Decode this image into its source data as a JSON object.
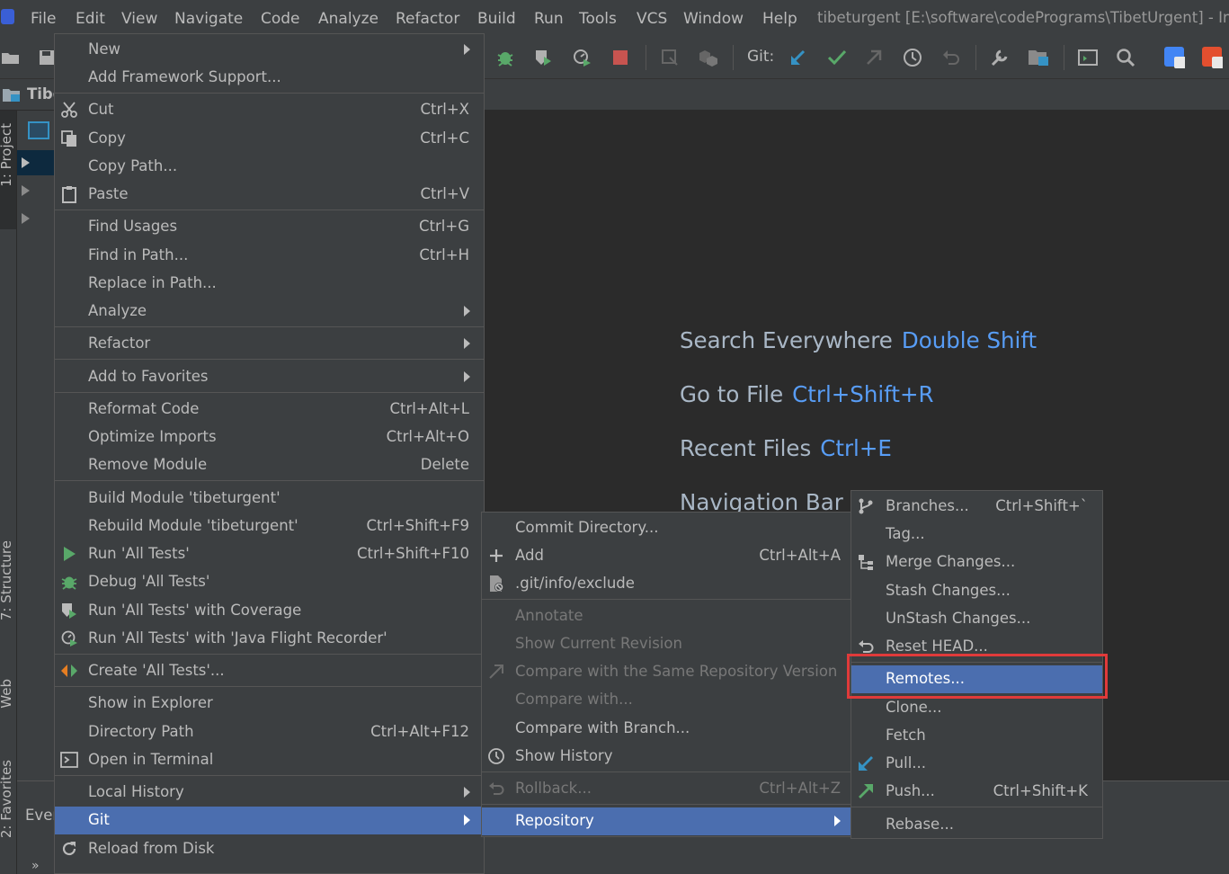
{
  "menubar": {
    "items": [
      "File",
      "Edit",
      "View",
      "Navigate",
      "Code",
      "Analyze",
      "Refactor",
      "Build",
      "Run",
      "Tools",
      "VCS",
      "Window",
      "Help"
    ],
    "title": "tibeturgent [E:\\software\\codePrograms\\TibetUrgent] - In"
  },
  "toolbar": {
    "git_label": "Git:"
  },
  "navbar": {
    "crumb": "Tibe"
  },
  "side_tabs": {
    "project": "1: Project",
    "structure": "7: Structure",
    "web": "Web",
    "favorites": "2: Favorites"
  },
  "bottom": {
    "events_label": "Ever",
    "expand": "»"
  },
  "editor": {
    "hints": [
      {
        "label": "Search Everywhere",
        "keys": "Double Shift"
      },
      {
        "label": "Go to File",
        "keys": "Ctrl+Shift+R"
      },
      {
        "label": "Recent Files",
        "keys": "Ctrl+E"
      },
      {
        "label": "Navigation Bar",
        "keys": ""
      }
    ]
  },
  "context_menu": {
    "items": [
      {
        "label": "New",
        "shortcut": ""
      },
      {
        "label": "Add Framework Support...",
        "shortcut": ""
      },
      {
        "label": "Cut",
        "shortcut": "Ctrl+X"
      },
      {
        "label": "Copy",
        "shortcut": "Ctrl+C"
      },
      {
        "label": "Copy Path...",
        "shortcut": ""
      },
      {
        "label": "Paste",
        "shortcut": "Ctrl+V"
      },
      {
        "label": "Find Usages",
        "shortcut": "Ctrl+G"
      },
      {
        "label": "Find in Path...",
        "shortcut": "Ctrl+H"
      },
      {
        "label": "Replace in Path...",
        "shortcut": ""
      },
      {
        "label": "Analyze",
        "shortcut": ""
      },
      {
        "label": "Refactor",
        "shortcut": ""
      },
      {
        "label": "Add to Favorites",
        "shortcut": ""
      },
      {
        "label": "Reformat Code",
        "shortcut": "Ctrl+Alt+L"
      },
      {
        "label": "Optimize Imports",
        "shortcut": "Ctrl+Alt+O"
      },
      {
        "label": "Remove Module",
        "shortcut": "Delete"
      },
      {
        "label": "Build Module 'tibeturgent'",
        "shortcut": ""
      },
      {
        "label": "Rebuild Module 'tibeturgent'",
        "shortcut": "Ctrl+Shift+F9"
      },
      {
        "label": "Run 'All Tests'",
        "shortcut": "Ctrl+Shift+F10"
      },
      {
        "label": "Debug 'All Tests'",
        "shortcut": ""
      },
      {
        "label": "Run 'All Tests' with Coverage",
        "shortcut": ""
      },
      {
        "label": "Run 'All Tests' with 'Java Flight Recorder'",
        "shortcut": ""
      },
      {
        "label": "Create 'All Tests'...",
        "shortcut": ""
      },
      {
        "label": "Show in Explorer",
        "shortcut": ""
      },
      {
        "label": "Directory Path",
        "shortcut": "Ctrl+Alt+F12"
      },
      {
        "label": "Open in Terminal",
        "shortcut": ""
      },
      {
        "label": "Local History",
        "shortcut": ""
      },
      {
        "label": "Git",
        "shortcut": ""
      },
      {
        "label": "Reload from Disk",
        "shortcut": ""
      }
    ]
  },
  "git_menu": {
    "items": [
      {
        "label": "Commit Directory...",
        "shortcut": ""
      },
      {
        "label": "Add",
        "shortcut": "Ctrl+Alt+A"
      },
      {
        "label": ".git/info/exclude",
        "shortcut": ""
      },
      {
        "label": "Annotate",
        "shortcut": ""
      },
      {
        "label": "Show Current Revision",
        "shortcut": ""
      },
      {
        "label": "Compare with the Same Repository Version",
        "shortcut": ""
      },
      {
        "label": "Compare with...",
        "shortcut": ""
      },
      {
        "label": "Compare with Branch...",
        "shortcut": ""
      },
      {
        "label": "Show History",
        "shortcut": ""
      },
      {
        "label": "Rollback...",
        "shortcut": "Ctrl+Alt+Z"
      },
      {
        "label": "Repository",
        "shortcut": ""
      }
    ]
  },
  "repo_menu": {
    "items": [
      {
        "label": "Branches...",
        "shortcut": "Ctrl+Shift+`"
      },
      {
        "label": "Tag...",
        "shortcut": ""
      },
      {
        "label": "Merge Changes...",
        "shortcut": ""
      },
      {
        "label": "Stash Changes...",
        "shortcut": ""
      },
      {
        "label": "UnStash Changes...",
        "shortcut": ""
      },
      {
        "label": "Reset HEAD...",
        "shortcut": ""
      },
      {
        "label": "Remotes...",
        "shortcut": ""
      },
      {
        "label": "Clone...",
        "shortcut": ""
      },
      {
        "label": "Fetch",
        "shortcut": ""
      },
      {
        "label": "Pull...",
        "shortcut": ""
      },
      {
        "label": "Push...",
        "shortcut": "Ctrl+Shift+K"
      },
      {
        "label": "Rebase...",
        "shortcut": ""
      }
    ]
  },
  "colors": {
    "selection": "#4b6eaf",
    "highlight_box": "#e03a3a",
    "hint_key": "#589df6",
    "run_green": "#59a869",
    "stop_red": "#c75450"
  }
}
